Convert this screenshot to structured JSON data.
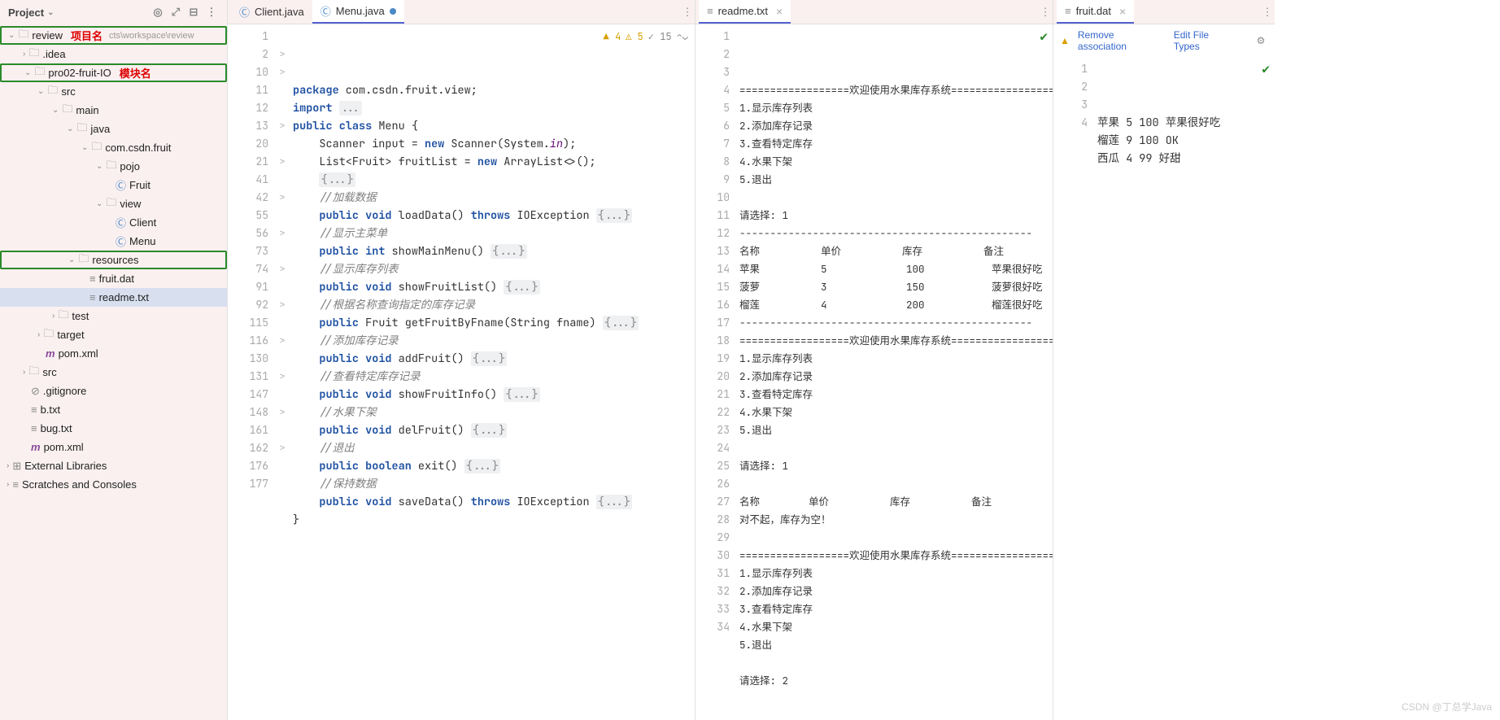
{
  "project": {
    "title": "Project",
    "path": "cts\\workspace\\review",
    "annot_project": "项目名",
    "annot_module": "模块名",
    "tree": {
      "review": "review",
      "idea": ".idea",
      "module": "pro02-fruit-IO",
      "src": "src",
      "main": "main",
      "java": "java",
      "pkg": "com.csdn.fruit",
      "pojo": "pojo",
      "fruit": "Fruit",
      "view": "view",
      "client": "Client",
      "menu": "Menu",
      "resources": "resources",
      "fruitdat": "fruit.dat",
      "readme": "readme.txt",
      "test": "test",
      "target": "target",
      "pom": "pom.xml",
      "src2": "src",
      "gitignore": ".gitignore",
      "btxt": "b.txt",
      "bugtxt": "bug.txt",
      "pom2": "pom.xml",
      "extlib": "External Libraries",
      "scratches": "Scratches and Consoles"
    }
  },
  "editor1": {
    "tab1": "Client.java",
    "tab2": "Menu.java",
    "status": {
      "warn": "4",
      "up": "5",
      "info": "15"
    },
    "lines": [
      {
        "n": "1",
        "f": "",
        "c": "<span class='kw'>package</span> com.csdn.fruit.view;"
      },
      {
        "n": "2",
        "f": ">",
        "c": "<span class='kw'>import</span> <span class='fold'>...</span>"
      },
      {
        "n": "10",
        "f": ">",
        "c": "<span class='kw'>public</span> <span class='kw'>class</span> Menu {"
      },
      {
        "n": "11",
        "f": "",
        "c": "    Scanner input = <span class='kw'>new</span> Scanner(System.<span class='it'>in</span>);"
      },
      {
        "n": "12",
        "f": "",
        "c": "    List&lt;Fruit&gt; fruitList = <span class='kw'>new</span> ArrayList&lt;&gt;();"
      },
      {
        "n": "13",
        "f": ">",
        "c": "    <span class='fold'>{...}</span>"
      },
      {
        "n": "20",
        "f": "",
        "c": "    <span class='cmt'>//加载数据</span>"
      },
      {
        "n": "21",
        "f": ">",
        "c": "    <span class='kw'>public</span> <span class='kw'>void</span> loadData() <span class='kw'>throws</span> IOException <span class='fold'>{...}</span>"
      },
      {
        "n": "41",
        "f": "",
        "c": "    <span class='cmt'>//显示主菜单</span>"
      },
      {
        "n": "42",
        "f": ">",
        "c": "    <span class='kw'>public</span> <span class='kw'>int</span> showMainMenu() <span class='fold'>{...}</span>"
      },
      {
        "n": "55",
        "f": "",
        "c": "    <span class='cmt'>//显示库存列表</span>"
      },
      {
        "n": "56",
        "f": ">",
        "c": "    <span class='kw'>public</span> <span class='kw'>void</span> showFruitList() <span class='fold'>{...}</span>"
      },
      {
        "n": "73",
        "f": "",
        "c": "    <span class='cmt'>//根据名称查询指定的库存记录</span>"
      },
      {
        "n": "74",
        "f": ">",
        "c": "    <span class='kw'>public</span> Fruit getFruitByFname(String fname) <span class='fold'>{...}</span>"
      },
      {
        "n": "91",
        "f": "",
        "c": "    <span class='cmt'>//添加库存记录</span>"
      },
      {
        "n": "92",
        "f": ">",
        "c": "    <span class='kw'>public</span> <span class='kw'>void</span> addFruit() <span class='fold'>{...}</span>"
      },
      {
        "n": "115",
        "f": "",
        "c": "    <span class='cmt'>//查看特定库存记录</span>"
      },
      {
        "n": "116",
        "f": ">",
        "c": "    <span class='kw'>public</span> <span class='kw'>void</span> showFruitInfo() <span class='fold'>{...}</span>"
      },
      {
        "n": "130",
        "f": "",
        "c": "    <span class='cmt'>//水果下架</span>"
      },
      {
        "n": "131",
        "f": ">",
        "c": "    <span class='kw'>public</span> <span class='kw'>void</span> delFruit() <span class='fold'>{...}</span>"
      },
      {
        "n": "147",
        "f": "",
        "c": "    <span class='cmt'>//退出</span>"
      },
      {
        "n": "148",
        "f": ">",
        "c": "    <span class='kw'>public</span> <span class='kw'>boolean</span> exit() <span class='fold'>{...}</span>"
      },
      {
        "n": "161",
        "f": "",
        "c": "    <span class='cmt'>//保持数据</span>"
      },
      {
        "n": "162",
        "f": ">",
        "c": "    <span class='kw'>public</span> <span class='kw'>void</span> saveData() <span class='kw'>throws</span> IOException <span class='fold'>{...}</span>"
      },
      {
        "n": "176",
        "f": "",
        "c": "}"
      },
      {
        "n": "177",
        "f": "",
        "c": ""
      }
    ]
  },
  "txtpanel": {
    "tab": "readme.txt",
    "lines": [
      "==================欢迎使用水果库存系统===================",
      "1.显示库存列表",
      "2.添加库存记录",
      "3.查看特定库存",
      "4.水果下架",
      "5.退出",
      "",
      "请选择: 1",
      "------------------------------------------------",
      "名称          单价          库存          备注",
      "苹果          5             100           苹果很好吃",
      "菠萝          3             150           菠萝很好吃",
      "榴莲          4             200           榴莲很好吃",
      "------------------------------------------------",
      "==================欢迎使用水果库存系统===================",
      "1.显示库存列表",
      "2.添加库存记录",
      "3.查看特定库存",
      "4.水果下架",
      "5.退出",
      "",
      "请选择: 1",
      "",
      "名称        单价          库存          备注",
      "对不起，库存为空！",
      "",
      "==================欢迎使用水果库存系统===================",
      "1.显示库存列表",
      "2.添加库存记录",
      "3.查看特定库存",
      "4.水果下架",
      "5.退出",
      "",
      "请选择: 2"
    ]
  },
  "datpanel": {
    "tab": "fruit.dat",
    "remove": "Remove association",
    "edit": "Edit File Types",
    "lines": [
      "苹果 5 100 苹果很好吃",
      "榴莲 9 100 OK",
      "西瓜 4 99 好甜",
      ""
    ]
  },
  "watermark": "CSDN @丁总学Java"
}
